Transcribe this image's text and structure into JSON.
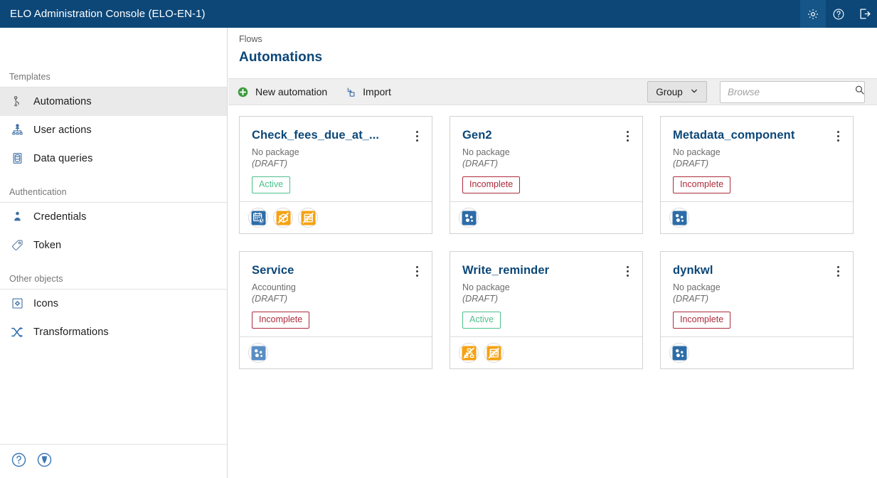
{
  "topbar": {
    "title": "ELO Administration Console (ELO-EN-1)",
    "actions": [
      {
        "name": "settings-icon",
        "label": "Settings"
      },
      {
        "name": "help-icon",
        "label": "Help"
      },
      {
        "name": "logout-icon",
        "label": "Log out"
      }
    ]
  },
  "sidebar": {
    "sections": [
      {
        "label": "Templates",
        "items": [
          {
            "label": "Automations",
            "icon": "automation-icon",
            "selected": true
          },
          {
            "label": "User actions",
            "icon": "user-actions-icon",
            "selected": false
          },
          {
            "label": "Data queries",
            "icon": "data-queries-icon",
            "selected": false
          }
        ]
      },
      {
        "label": "Authentication",
        "items": [
          {
            "label": "Credentials",
            "icon": "credentials-icon",
            "selected": false
          },
          {
            "label": "Token",
            "icon": "token-icon",
            "selected": false
          }
        ]
      },
      {
        "label": "Other objects",
        "items": [
          {
            "label": "Icons",
            "icon": "icons-icon",
            "selected": false
          },
          {
            "label": "Transformations",
            "icon": "transformations-icon",
            "selected": false
          }
        ]
      }
    ],
    "footer": [
      {
        "name": "help-circle-icon",
        "label": "Help"
      },
      {
        "name": "support-circle-icon",
        "label": "Support"
      }
    ]
  },
  "content": {
    "breadcrumb": "Flows",
    "page_title": "Automations",
    "toolbar": {
      "new_automation_label": "New automation",
      "import_label": "Import",
      "group_label": "Group",
      "search_placeholder": "Browse",
      "search_value": ""
    },
    "cards": [
      {
        "name": "Check_fees_due_at_...",
        "package": "No package",
        "state": "(DRAFT)",
        "badge": "Active",
        "badge_kind": "active",
        "icons": [
          "calendar-clock-icon",
          "package-box-icon",
          "form-table-icon"
        ]
      },
      {
        "name": "Gen2",
        "package": "No package",
        "state": "(DRAFT)",
        "badge": "Incomplete",
        "badge_kind": "incomplete",
        "icons": [
          "nodes-icon"
        ]
      },
      {
        "name": "Metadata_component",
        "package": "No package",
        "state": "(DRAFT)",
        "badge": "Incomplete",
        "badge_kind": "incomplete",
        "icons": [
          "nodes-icon"
        ]
      },
      {
        "name": "Service",
        "package": "Accounting",
        "state": "(DRAFT)",
        "badge": "Incomplete",
        "badge_kind": "incomplete",
        "icons": [
          "nodes-icon-light"
        ]
      },
      {
        "name": "Write_reminder",
        "package": "No package",
        "state": "(DRAFT)",
        "badge": "Active",
        "badge_kind": "active",
        "icons": [
          "workflow-icon",
          "form-table-icon"
        ]
      },
      {
        "name": "dynkwl",
        "package": "No package",
        "state": "(DRAFT)",
        "badge": "Incomplete",
        "badge_kind": "incomplete",
        "icons": [
          "nodes-icon"
        ]
      }
    ]
  },
  "colors": {
    "brand_blue": "#0c4778",
    "accent_orange": "#f5a213",
    "icon_blue": "#2d6ca8",
    "status_active": "#4cc08d",
    "status_incomplete": "#ac2b3c"
  }
}
